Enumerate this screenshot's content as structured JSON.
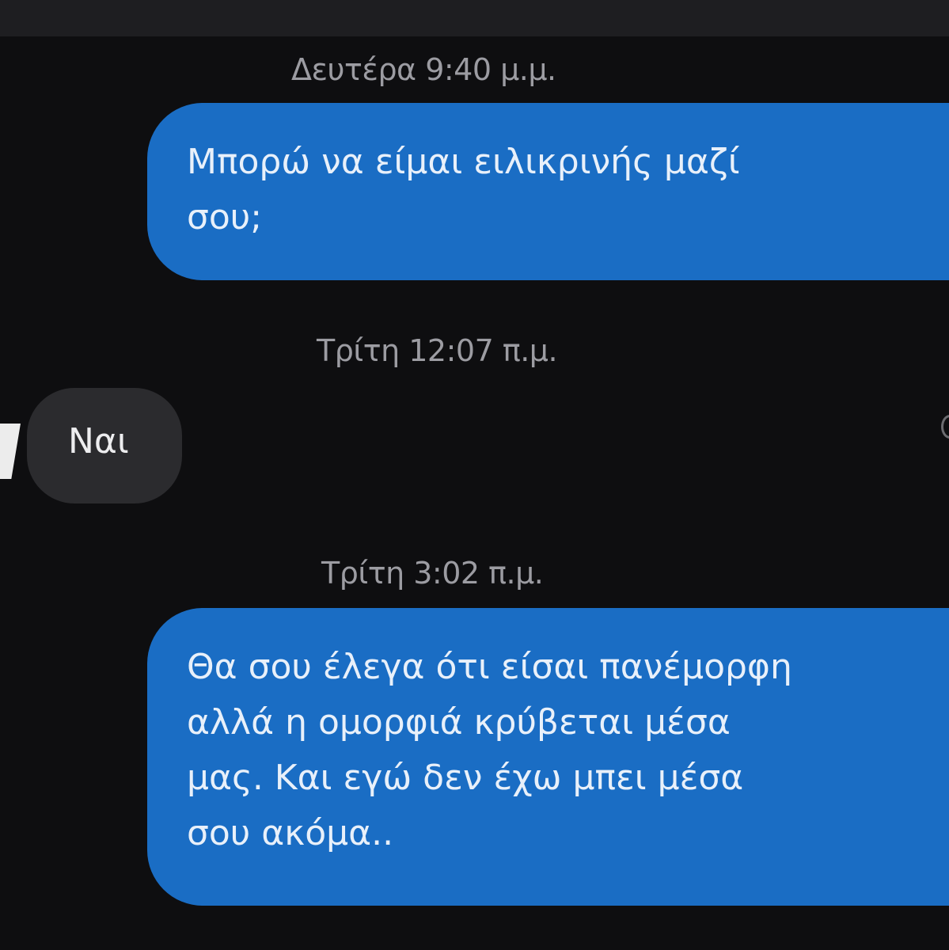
{
  "messages": [
    {
      "timestamp": "Δευτέρα 9:40 μ.μ.",
      "direction": "outgoing",
      "text": "Μπορώ να είμαι ειλικρινής μαζί\nσου;"
    },
    {
      "timestamp": "Τρίτη 12:07 π.μ.",
      "direction": "incoming",
      "text": "Ναι"
    },
    {
      "timestamp": "Τρίτη 3:02 π.μ.",
      "direction": "outgoing",
      "text": "Θα σου έλεγα ότι είσαι πανέμορφη\nαλλά η ομορφιά κρύβεται μέσα\nμας. Και εγώ δεν έχω μπει μέσα\nσου ακόμα.."
    }
  ],
  "colors": {
    "outgoing_bubble": "#1a6dc4",
    "incoming_bubble": "#2b2b2e",
    "background": "#0e0e10",
    "timestamp_text": "#9c9ca2"
  }
}
